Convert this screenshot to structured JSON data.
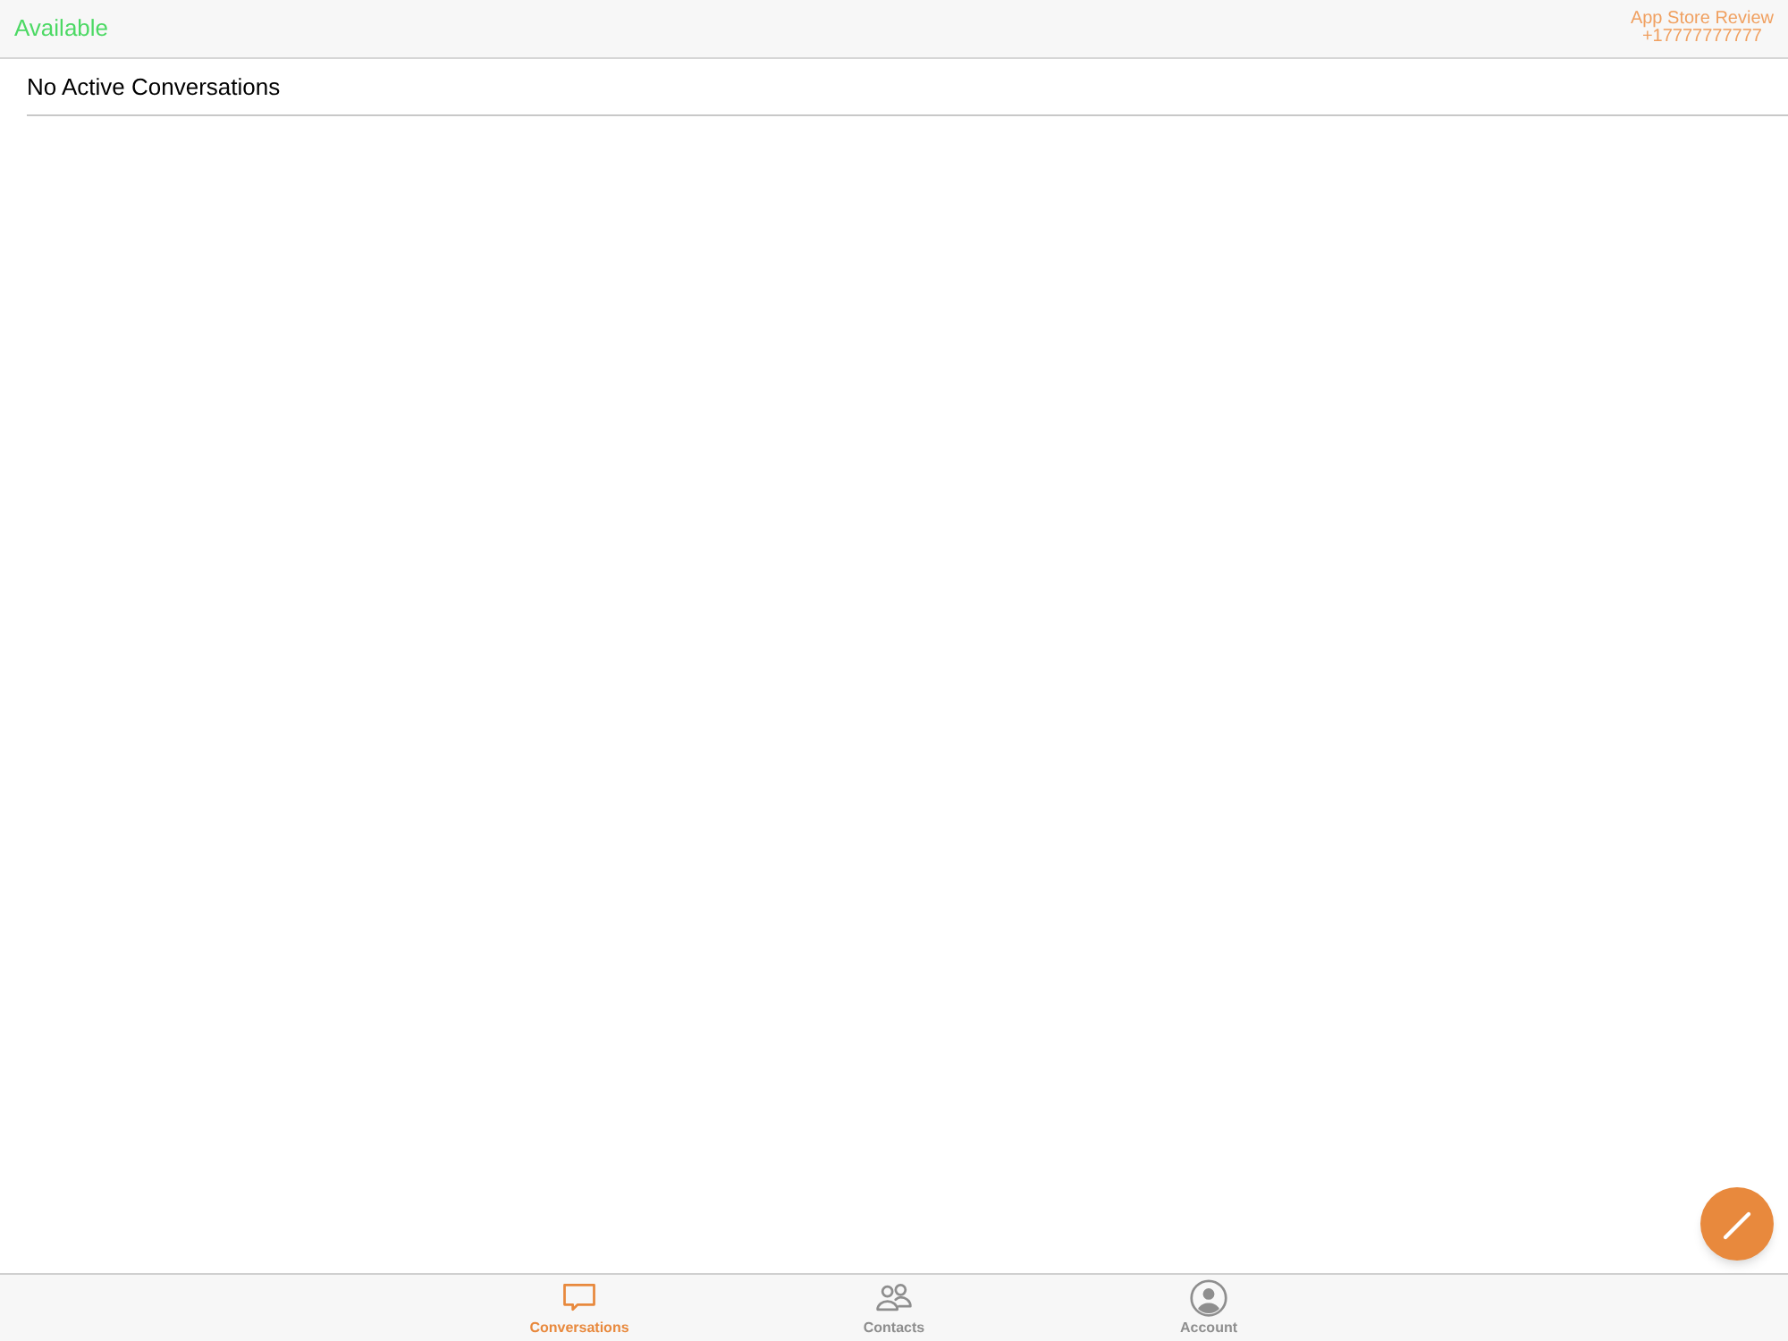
{
  "header": {
    "status": "Available",
    "account_name": "App Store Review",
    "account_number": "+17777777777"
  },
  "conversations": {
    "empty_message": "No Active Conversations"
  },
  "tabs": [
    {
      "label": "Conversations",
      "kind": "chat",
      "selected": true
    },
    {
      "label": "Contacts",
      "kind": "contacts",
      "selected": false
    },
    {
      "label": "Account",
      "kind": "account",
      "selected": false
    }
  ]
}
